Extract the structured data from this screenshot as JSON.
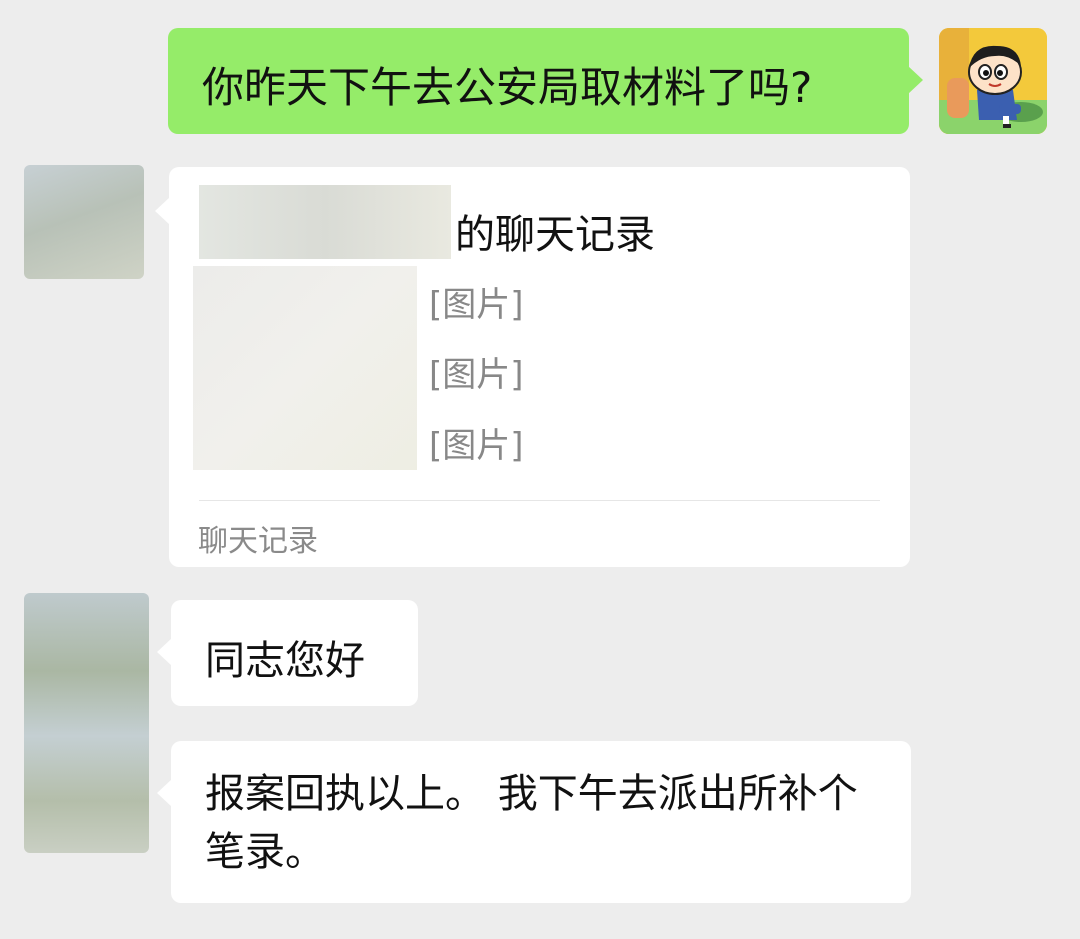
{
  "messages": {
    "sent_1": {
      "text": "你昨天下午去公安局取材料了吗?"
    },
    "chat_record_card": {
      "title_suffix": "的聊天记录",
      "lines": [
        "[图片]",
        "[图片]",
        "[图片]"
      ],
      "footer": "聊天记录"
    },
    "received_1": {
      "text": "同志您好"
    },
    "received_2": {
      "text": "报案回执以上。 我下午去派出所补个笔录。"
    }
  },
  "colors": {
    "background": "#ededed",
    "sent_bubble": "#95ec69",
    "received_bubble": "#ffffff"
  },
  "icons": {
    "my_avatar": "cartoon-boy-avatar-icon"
  }
}
